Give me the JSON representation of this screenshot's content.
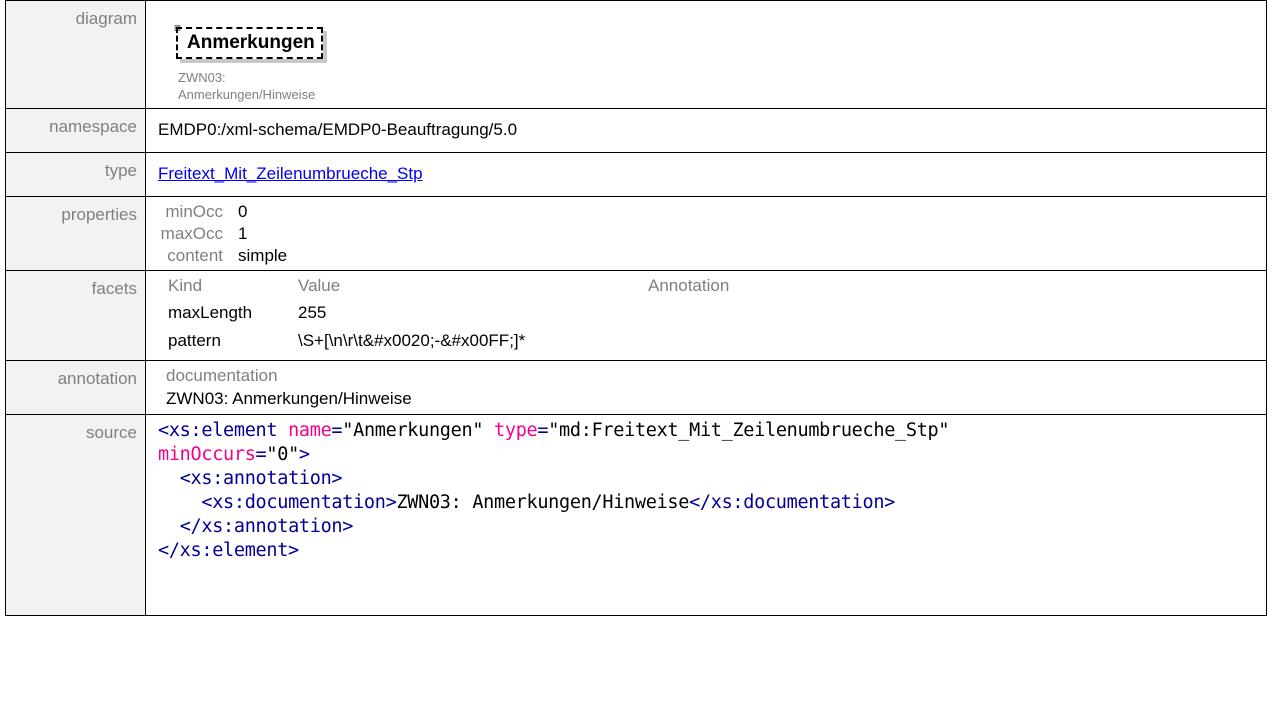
{
  "rows": {
    "diagram": {
      "label": "diagram"
    },
    "namespace": {
      "label": "namespace",
      "value": "EMDP0:/xml-schema/EMDP0-Beauftragung/5.0"
    },
    "type": {
      "label": "type",
      "value": "Freitext_Mit_Zeilenumbrueche_Stp"
    },
    "properties": {
      "label": "properties"
    },
    "facets": {
      "label": "facets"
    },
    "annotation": {
      "label": "annotation"
    },
    "source": {
      "label": "source"
    }
  },
  "diagram": {
    "element_name": "Anmerkungen",
    "subtitle_line1": "ZWN03:",
    "subtitle_line2": "Anmerkungen/Hinweise",
    "icon": "sequence-lines-icon"
  },
  "properties": [
    {
      "key": "minOcc",
      "value": "0"
    },
    {
      "key": "maxOcc",
      "value": "1"
    },
    {
      "key": "content",
      "value": "simple"
    }
  ],
  "facets": {
    "headers": {
      "kind": "Kind",
      "value": "Value",
      "annotation": "Annotation"
    },
    "items": [
      {
        "kind": "maxLength",
        "value": "255"
      },
      {
        "kind": "pattern",
        "value": "\\S+[\\n\\r\\t&#x0020;-&#x00FF;]*"
      }
    ]
  },
  "annotation": {
    "heading": "documentation",
    "text": "ZWN03: Anmerkungen/Hinweise"
  },
  "source": {
    "l1_open": "<xs:element",
    "l1_attr1": "name",
    "l1_val1": "\"Anmerkungen\"",
    "l1_attr2": "type",
    "l1_val2": "\"md:Freitext_Mit_Zeilenumbrueche_Stp\"",
    "l2_attr": "minOccurs",
    "l2_val": "\"0\"",
    "l2_close": ">",
    "l3": "<xs:annotation>",
    "l4_open": "<xs:documentation>",
    "l4_text": "ZWN03: Anmerkungen/Hinweise",
    "l4_close": "</xs:documentation>",
    "l5": "</xs:annotation>",
    "l6": "</xs:element>"
  },
  "colors": {
    "tag": "#000096",
    "attr": "#f5008c",
    "label_bg": "#f2f2f2",
    "label_text": "#808080"
  }
}
